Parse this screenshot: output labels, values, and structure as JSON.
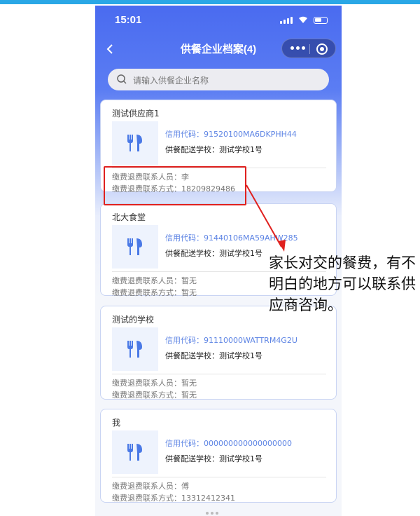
{
  "status": {
    "time": "15:01"
  },
  "header": {
    "title": "供餐企业档案(4)",
    "back_icon": "chevron-left-icon"
  },
  "search": {
    "placeholder": "请输入供餐企业名称"
  },
  "cards": [
    {
      "name": "测试供应商1",
      "code": "信用代码：91520100MA6DKPHH44",
      "school": "供餐配送学校：测试学校1号",
      "contact": "缴费退费联系人员：李",
      "phone": "缴费退费联系方式：18209829486"
    },
    {
      "name": "北大食堂",
      "code": "信用代码：91440106MA59AHW285",
      "school": "供餐配送学校：测试学校1号",
      "contact": "缴费退费联系人员：暂无",
      "phone": "缴费退费联系方式：暂无"
    },
    {
      "name": "测试的学校",
      "code": "信用代码：91110000WATTRM4G2U",
      "school": "供餐配送学校：测试学校1号",
      "contact": "缴费退费联系人员：暂无",
      "phone": "缴费退费联系方式：暂无"
    },
    {
      "name": "我",
      "code": "信用代码：000000000000000000",
      "school": "供餐配送学校：测试学校1号",
      "contact": "缴费退费联系人员：傅",
      "phone": "缴费退费联系方式：13312412341"
    }
  ],
  "annotation": {
    "text": "家长对交的餐费，有不明白的地方可以联系供应商咨询。",
    "color": "#e0211f"
  },
  "colors": {
    "accent": "#4a6bf0",
    "code_text": "#5d84e4"
  }
}
